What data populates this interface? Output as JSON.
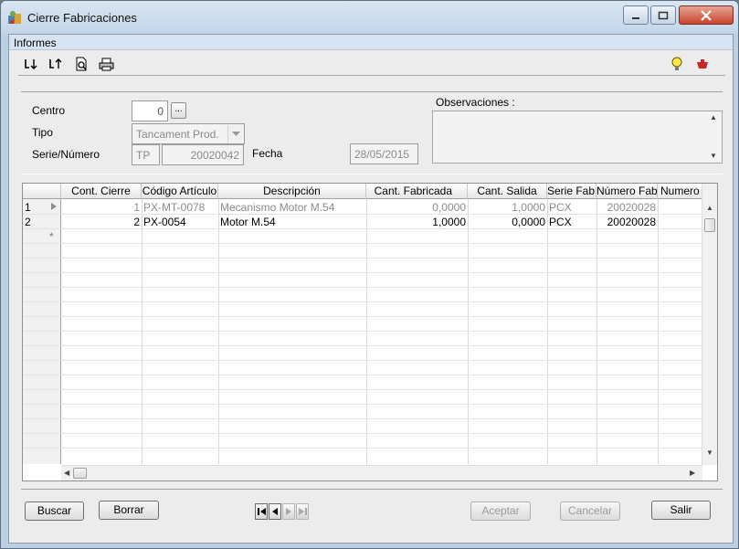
{
  "window": {
    "title": "Cierre Fabricaciones"
  },
  "menu": {
    "informes": "Informes"
  },
  "toolbar": {
    "sort_asc": "sort-ascending-icon",
    "sort_desc": "sort-descending-icon",
    "preview": "print-preview-icon",
    "print": "print-icon",
    "tip": "lightbulb-icon",
    "help": "help-icon"
  },
  "form": {
    "centro_label": "Centro",
    "centro_value": "0",
    "centro_btn": "...",
    "tipo_label": "Tipo",
    "tipo_value": "Tancament Prod.",
    "serie_label": "Serie/Número",
    "serie_value": "TP",
    "numero_value": "20020042",
    "fecha_label": "Fecha",
    "fecha_value": "28/05/2015",
    "observaciones_label": "Observaciones :"
  },
  "grid": {
    "columns": [
      "Cont. Cierre",
      "Código Artículo",
      "Descripción",
      "Cant. Fabricada",
      "Cant. Salida",
      "Serie Fab.",
      "Número Fab.",
      "Numero A"
    ],
    "rows": [
      {
        "num": "1",
        "cont": "1",
        "codigo": "PX-MT-0078",
        "desc": "Mecanismo Motor M.54",
        "fabricada": "0,0000",
        "salida": "1,0000",
        "serie": "PCX",
        "numero": "20020028"
      },
      {
        "num": "2",
        "cont": "2",
        "codigo": "PX-0054",
        "desc": "Motor M.54",
        "fabricada": "1,0000",
        "salida": "0,0000",
        "serie": "PCX",
        "numero": "20020028"
      }
    ],
    "new_row_marker": "*"
  },
  "buttons": {
    "buscar": "Buscar",
    "borrar": "Borrar",
    "aceptar": "Aceptar",
    "cancelar": "Cancelar",
    "salir": "Salir"
  },
  "colors": {
    "titlebar": "#c2d5e7",
    "panel": "#ececec",
    "close": "#c9452d"
  }
}
